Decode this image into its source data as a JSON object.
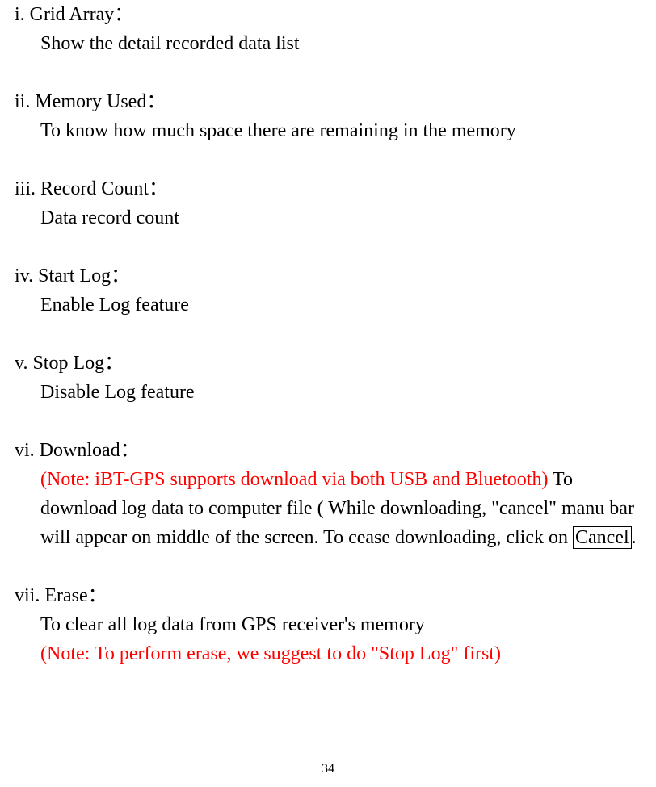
{
  "sections": {
    "s1": {
      "head": "i. Grid Array：",
      "body": "Show the detail recorded data list"
    },
    "s2": {
      "head": "ii. Memory Used：",
      "body": "To know how much space there are remaining in the memory"
    },
    "s3": {
      "head": "iii. Record Count：",
      "body": "Data record count"
    },
    "s4": {
      "head": "iv. Start Log：",
      "body": "Enable Log feature"
    },
    "s5": {
      "head": "v. Stop Log：",
      "body": "Disable Log feature"
    },
    "s6": {
      "head": "vi. Download：",
      "note": "(Note: iBT-GPS supports download via both USB and Bluetooth)",
      "body_a": "To download log data to computer file ( While downloading, \"cancel\" manu bar will appear on middle of the screen. To cease downloading, click on ",
      "cancel": "Cancel",
      "body_b": "."
    },
    "s7": {
      "head": "vii. Erase：",
      "body": "To clear all log data from GPS receiver's memory",
      "note": "(Note: To perform erase, we suggest to do \"Stop Log\" first)"
    }
  },
  "page_number": "34"
}
